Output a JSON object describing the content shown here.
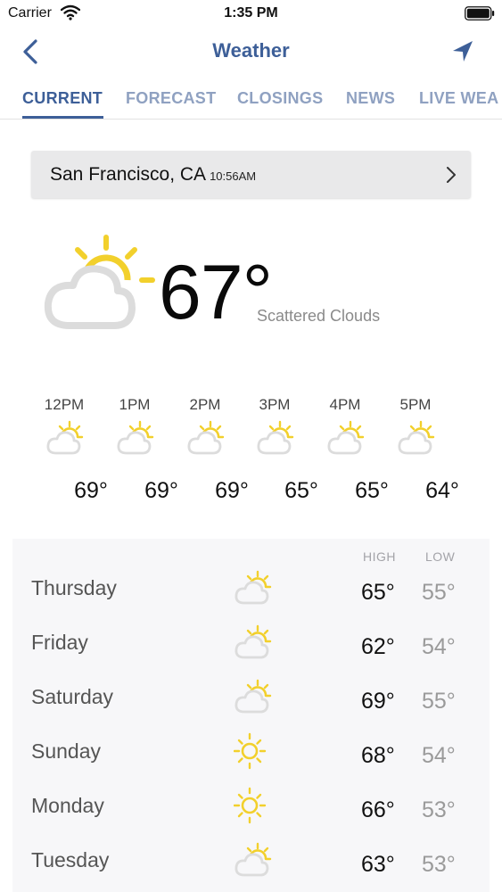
{
  "status_bar": {
    "carrier": "Carrier",
    "time": "1:35 PM"
  },
  "nav": {
    "title": "Weather"
  },
  "tabs": [
    {
      "label": "CURRENT",
      "active": true
    },
    {
      "label": "FORECAST",
      "active": false
    },
    {
      "label": "CLOSINGS",
      "active": false
    },
    {
      "label": "NEWS",
      "active": false
    },
    {
      "label": "LIVE WEA",
      "active": false
    }
  ],
  "location": {
    "city": "San Francisco, CA",
    "time": "10:56AM"
  },
  "current": {
    "temp": "67°",
    "condition": "Scattered Clouds",
    "icon": "partly-cloudy-icon"
  },
  "hourly": [
    {
      "time": "12PM",
      "temp": "69°",
      "icon": "partly-cloudy-icon"
    },
    {
      "time": "1PM",
      "temp": "69°",
      "icon": "partly-cloudy-icon"
    },
    {
      "time": "2PM",
      "temp": "69°",
      "icon": "partly-cloudy-icon"
    },
    {
      "time": "3PM",
      "temp": "65°",
      "icon": "partly-cloudy-icon"
    },
    {
      "time": "4PM",
      "temp": "65°",
      "icon": "partly-cloudy-icon"
    },
    {
      "time": "5PM",
      "temp": "64°",
      "icon": "partly-cloudy-icon"
    }
  ],
  "daily": {
    "high_label": "HIGH",
    "low_label": "LOW",
    "days": [
      {
        "day": "Thursday",
        "high": "65°",
        "low": "55°",
        "icon": "partly-cloudy-icon"
      },
      {
        "day": "Friday",
        "high": "62°",
        "low": "54°",
        "icon": "partly-cloudy-icon"
      },
      {
        "day": "Saturday",
        "high": "69°",
        "low": "55°",
        "icon": "partly-cloudy-icon"
      },
      {
        "day": "Sunday",
        "high": "68°",
        "low": "54°",
        "icon": "sunny-icon"
      },
      {
        "day": "Monday",
        "high": "66°",
        "low": "53°",
        "icon": "sunny-icon"
      },
      {
        "day": "Tuesday",
        "high": "63°",
        "low": "53°",
        "icon": "partly-cloudy-icon"
      }
    ]
  },
  "colors": {
    "accent": "#3d5f98",
    "tab_inactive": "#8fa1c1",
    "sun": "#f2d02c",
    "cloud": "#dcdcdc"
  }
}
